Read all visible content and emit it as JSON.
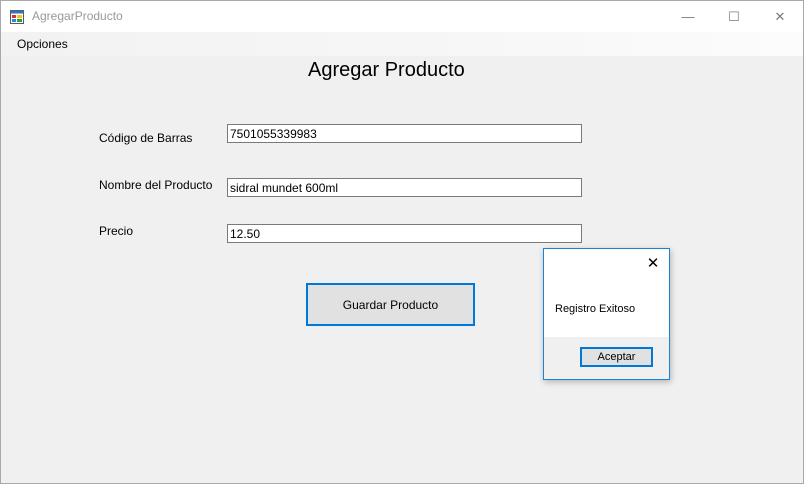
{
  "window": {
    "title": "AgregarProducto",
    "minimize_glyph": "—",
    "maximize_glyph": "☐",
    "close_glyph": "✕",
    "app_icon": "form-app-icon"
  },
  "menu": {
    "items": [
      {
        "label": "Opciones"
      }
    ]
  },
  "form": {
    "title": "Agregar Producto",
    "fields": [
      {
        "label": "Código de Barras",
        "value": "7501055339983"
      },
      {
        "label": "Nombre del Producto",
        "value": "sidral mundet 600ml"
      },
      {
        "label": "Precio",
        "value": "12.50"
      }
    ],
    "save_label": "Guardar Producto"
  },
  "dialog": {
    "message": "Registro Exitoso",
    "ok_label": "Aceptar",
    "close_glyph": "✕"
  },
  "colors": {
    "accent": "#0078d7",
    "window_bg": "#f0f0f0",
    "title_text": "#999999"
  }
}
